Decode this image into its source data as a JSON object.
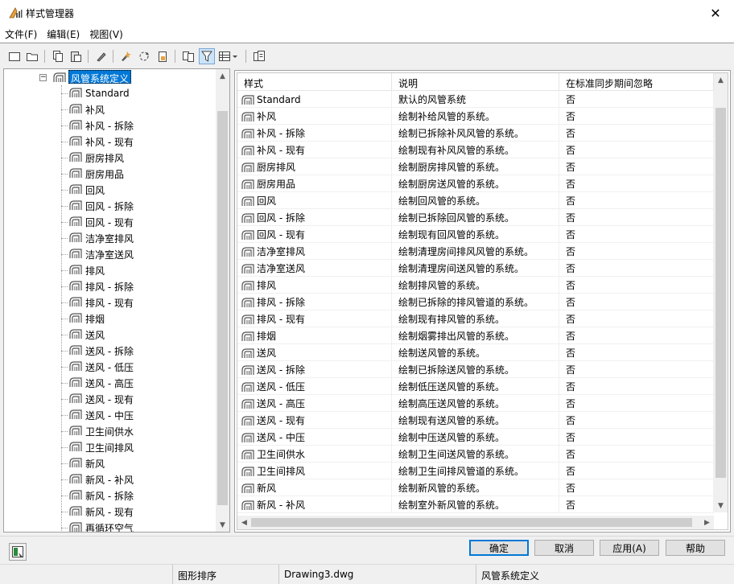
{
  "window": {
    "title": "样式管理器",
    "close_glyph": "✕"
  },
  "menu": [
    "文件(F)",
    "编辑(E)",
    "视图(V)"
  ],
  "toolbar": {
    "buttons": [
      "new-icon",
      "open-icon",
      "copy-icon",
      "paste-icon",
      "edit-icon",
      "purge-icon",
      "refresh-icon",
      "drawing-icon",
      "compare-icon",
      "filter-icon",
      "view-toggle-icon",
      "properties-icon"
    ]
  },
  "tree": {
    "root_label": "风管系统定义",
    "items": [
      "Standard",
      "补风",
      "补风 - 拆除",
      "补风 - 现有",
      "厨房排风",
      "厨房用品",
      "回风",
      "回风 - 拆除",
      "回风 - 现有",
      "洁净室排风",
      "洁净室送风",
      "排风",
      "排风 - 拆除",
      "排风 - 现有",
      "排烟",
      "送风",
      "送风 - 拆除",
      "送风 - 低压",
      "送风 - 高压",
      "送风 - 现有",
      "送风 - 中压",
      "卫生间供水",
      "卫生间排风",
      "新风",
      "新风 - 补风",
      "新风 - 拆除",
      "新风 - 现有",
      "再循环空气"
    ]
  },
  "list": {
    "columns": [
      "样式",
      "说明",
      "在标准同步期间忽略"
    ],
    "rows": [
      [
        "Standard",
        "默认的风管系统",
        "否"
      ],
      [
        "补风",
        "绘制补给风管的系统。",
        "否"
      ],
      [
        "补风 - 拆除",
        "绘制已拆除补风风管的系统。",
        "否"
      ],
      [
        "补风 - 现有",
        "绘制现有补风风管的系统。",
        "否"
      ],
      [
        "厨房排风",
        "绘制厨房排风管的系统。",
        "否"
      ],
      [
        "厨房用品",
        "绘制厨房送风管的系统。",
        "否"
      ],
      [
        "回风",
        "绘制回风管的系统。",
        "否"
      ],
      [
        "回风 - 拆除",
        "绘制已拆除回风管的系统。",
        "否"
      ],
      [
        "回风 - 现有",
        "绘制现有回风管的系统。",
        "否"
      ],
      [
        "洁净室排风",
        "绘制清理房间排风风管的系统。",
        "否"
      ],
      [
        "洁净室送风",
        "绘制清理房间送风管的系统。",
        "否"
      ],
      [
        "排风",
        "绘制排风管的系统。",
        "否"
      ],
      [
        "排风 - 拆除",
        "绘制已拆除的排风管道的系统。",
        "否"
      ],
      [
        "排风 - 现有",
        "绘制现有排风管的系统。",
        "否"
      ],
      [
        "排烟",
        "绘制烟雾排出风管的系统。",
        "否"
      ],
      [
        "送风",
        "绘制送风管的系统。",
        "否"
      ],
      [
        "送风 - 拆除",
        "绘制已拆除送风管的系统。",
        "否"
      ],
      [
        "送风 - 低压",
        "绘制低压送风管的系统。",
        "否"
      ],
      [
        "送风 - 高压",
        "绘制高压送风管的系统。",
        "否"
      ],
      [
        "送风 - 现有",
        "绘制现有送风管的系统。",
        "否"
      ],
      [
        "送风 - 中压",
        "绘制中压送风管的系统。",
        "否"
      ],
      [
        "卫生间供水",
        "绘制卫生间送风管的系统。",
        "否"
      ],
      [
        "卫生间排风",
        "绘制卫生间排风管道的系统。",
        "否"
      ],
      [
        "新风",
        "绘制新风管的系统。",
        "否"
      ],
      [
        "新风 - 补风",
        "绘制室外新风管的系统。",
        "否"
      ]
    ]
  },
  "buttons": {
    "ok": "确定",
    "cancel": "取消",
    "apply": "应用(A)",
    "help": "帮助"
  },
  "status": {
    "sort": "图形排序",
    "drawing": "Drawing3.dwg",
    "category": "风管系统定义"
  }
}
